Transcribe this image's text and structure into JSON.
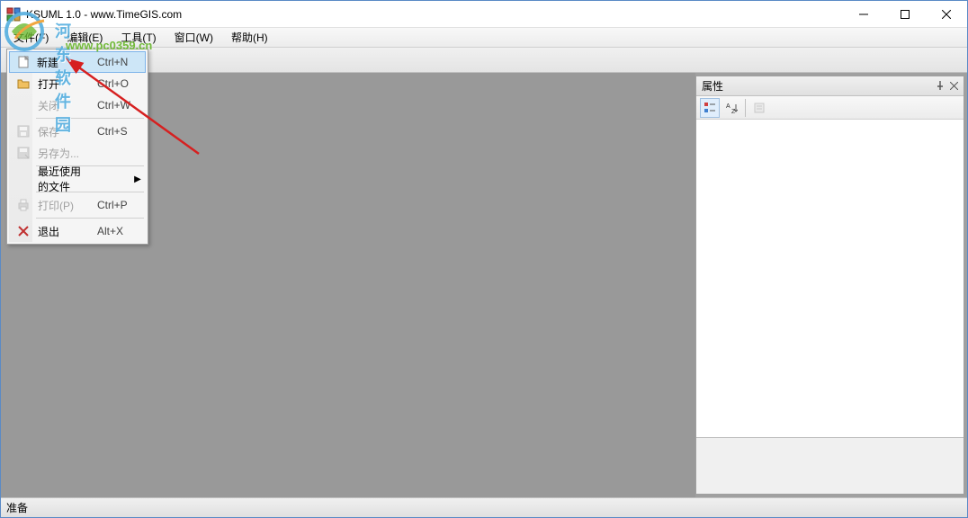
{
  "title": "KSUML 1.0 - www.TimeGIS.com",
  "menubar": {
    "file": "文件(F)",
    "edit": "编辑(E)",
    "tools": "工具(T)",
    "window": "窗口(W)",
    "help": "帮助(H)"
  },
  "dropdown": {
    "new": {
      "label": "新建",
      "shortcut": "Ctrl+N"
    },
    "open": {
      "label": "打开",
      "shortcut": "Ctrl+O"
    },
    "close": {
      "label": "关闭",
      "shortcut": "Ctrl+W"
    },
    "save": {
      "label": "保存",
      "shortcut": "Ctrl+S"
    },
    "saveas": {
      "label": "另存为...",
      "shortcut": ""
    },
    "recent": {
      "label": "最近使用的文件",
      "shortcut": ""
    },
    "print": {
      "label": "打印(P)",
      "shortcut": "Ctrl+P"
    },
    "exit": {
      "label": "退出",
      "shortcut": "Alt+X"
    }
  },
  "props": {
    "title": "属性"
  },
  "status": "准备",
  "watermark": {
    "text": "河东软件园",
    "url": "www.pc0359.cn"
  }
}
